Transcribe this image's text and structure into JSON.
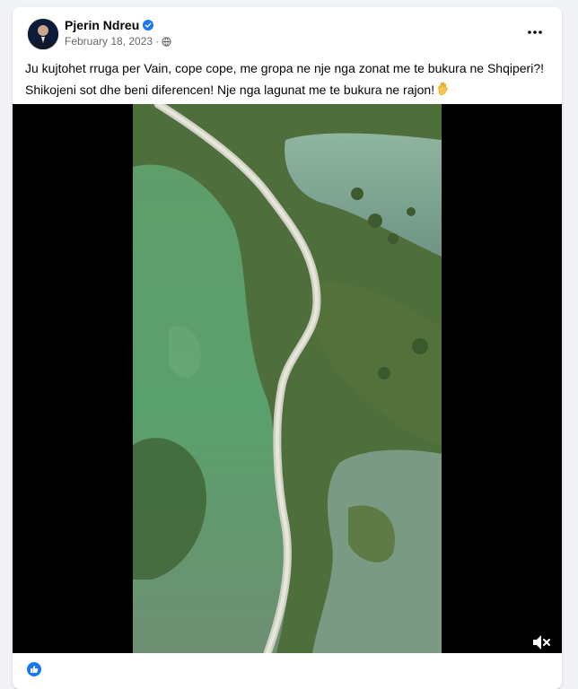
{
  "post": {
    "author": "Pjerin Ndreu",
    "verified": true,
    "date": "February 18, 2023",
    "separator": "·",
    "audience_icon": "globe-icon",
    "more_icon": "more-dots-icon",
    "text_line1": "Ju kujtohet rruga per Vain, cope cope, me gropa ne nje nga zonat me te bukura ne Shqiperi?!",
    "text_line2": "Shikojeni sot dhe beni diferencen! Nje nga lagunat me te bukura ne rajon!",
    "text_emoji_icon": "ok-hand-icon"
  },
  "video": {
    "description_icon": "aerial-lagoon-road-frame",
    "mute_icon": "speaker-muted-icon"
  },
  "colors": {
    "accent": "#1877f2",
    "text": "#050505",
    "secondary": "#65676b",
    "background": "#f0f2f5"
  }
}
